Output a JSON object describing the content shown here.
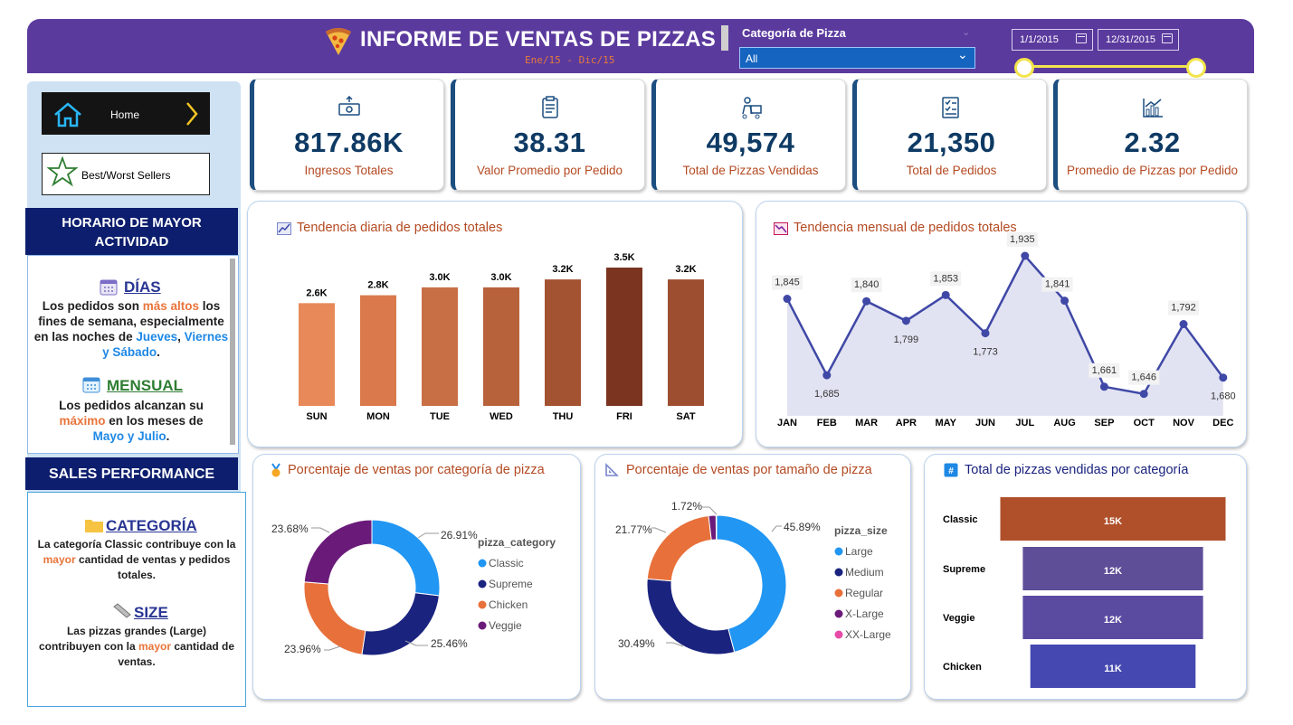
{
  "header": {
    "title": "INFORME DE VENTAS DE PIZZAS",
    "subtitle": "Ene/15 - Dic/15",
    "slicer_label": "Categoría de Pizza",
    "slicer_value": "All",
    "date_start": "1/1/2015",
    "date_end": "12/31/2015",
    "colors": {
      "header_bg": "#5b3a9e",
      "slider": "#f3e44c"
    }
  },
  "nav": {
    "home_label": "Home",
    "best_worst_label": "Best/Worst Sellers"
  },
  "insights": {
    "horario_header": "HORARIO DE MAYOR ACTIVIDAD",
    "dias_title": "DÍAS",
    "dias_text_a": "Los pedidos son ",
    "dias_text_b": "más altos",
    "dias_text_c": " los fines de semana, especialmente en las noches de ",
    "dias_text_d": "Jueves",
    "dias_text_e": ", ",
    "dias_text_f": "Viernes y Sábado",
    "dias_text_g": ".",
    "mensual_title": "MENSUAL",
    "mensual_text_a": "Los pedidos alcanzan su ",
    "mensual_text_b": "máximo",
    "mensual_text_c": " en los meses de ",
    "mensual_text_d": "Mayo y Julio",
    "mensual_text_e": ".",
    "sales_header": "SALES PERFORMANCE",
    "categoria_title": "CATEGORÍA",
    "categoria_text_a": "La categoría Classic contribuye con la ",
    "categoria_text_b": "mayor",
    "categoria_text_c": " cantidad de ventas y pedidos totales.",
    "size_title": "SIZE",
    "size_text_a": "Las pizzas grandes (Large) contribuyen con la ",
    "size_text_b": "mayor",
    "size_text_c": " cantidad de ventas."
  },
  "kpis": [
    {
      "value": "817.86K",
      "label": "Ingresos Totales",
      "icon": "money-icon"
    },
    {
      "value": "38.31",
      "label": "Valor Promedio por Pedido",
      "icon": "clipboard-icon"
    },
    {
      "value": "49,574",
      "label": "Total de Pizzas Vendidas",
      "icon": "delivery-icon"
    },
    {
      "value": "21,350",
      "label": "Total de Pedidos",
      "icon": "checklist-icon"
    },
    {
      "value": "2.32",
      "label": "Promedio de Pizzas por Pedido",
      "icon": "bar-chart-icon"
    }
  ],
  "chart_data": [
    {
      "type": "bar",
      "title": "Tendencia diaria de pedidos totales",
      "categories": [
        "SUN",
        "MON",
        "TUE",
        "WED",
        "THU",
        "FRI",
        "SAT"
      ],
      "values": [
        2.6,
        2.8,
        3.0,
        3.0,
        3.2,
        3.5,
        3.2
      ],
      "labels": [
        "2.6K",
        "2.8K",
        "3.0K",
        "3.0K",
        "3.2K",
        "3.5K",
        "3.2K"
      ],
      "colors": [
        "#e8895a",
        "#d9794c",
        "#c96f46",
        "#b8623c",
        "#a35232",
        "#7a3420",
        "#9e4e30"
      ]
    },
    {
      "type": "area",
      "title": "Tendencia mensual de pedidos totales",
      "categories": [
        "JAN",
        "FEB",
        "MAR",
        "APR",
        "MAY",
        "JUN",
        "JUL",
        "AUG",
        "SEP",
        "OCT",
        "NOV",
        "DEC"
      ],
      "values": [
        1845,
        1685,
        1840,
        1799,
        1853,
        1773,
        1935,
        1841,
        1661,
        1646,
        1792,
        1680
      ],
      "labels": [
        "1,845",
        "1,685",
        "1,840",
        "1,799",
        "1,853",
        "1,773",
        "1,935",
        "1,841",
        "1,661",
        "1,646",
        "1,792",
        "1,680"
      ],
      "colors": {
        "line": "#3f48a6",
        "fill": "#e2e3f2"
      }
    },
    {
      "type": "pie",
      "title": "Porcentaje de ventas por categoría de pizza",
      "legend_title": "pizza_category",
      "categories": [
        "Classic",
        "Supreme",
        "Chicken",
        "Veggie"
      ],
      "values": [
        26.91,
        25.46,
        23.96,
        23.68
      ],
      "labels": [
        "26.91%",
        "25.46%",
        "23.96%",
        "23.68%"
      ],
      "colors": [
        "#2196f3",
        "#1a237e",
        "#e8703a",
        "#6a1b7a"
      ]
    },
    {
      "type": "pie",
      "title": "Porcentaje de ventas por tamaño de pizza",
      "legend_title": "pizza_size",
      "categories": [
        "Large",
        "Medium",
        "Regular",
        "X-Large",
        "XX-Large"
      ],
      "values": [
        45.89,
        30.49,
        21.77,
        1.72,
        0.13
      ],
      "labels": [
        "45.89%",
        "30.49%",
        "21.77%",
        "1.72%"
      ],
      "colors": [
        "#2196f3",
        "#1a237e",
        "#e8703a",
        "#6a1b7a",
        "#e84aa8"
      ]
    },
    {
      "type": "bar",
      "orientation": "horizontal",
      "title": "Total de pizzas vendidas por categoría",
      "categories": [
        "Classic",
        "Supreme",
        "Veggie",
        "Chicken"
      ],
      "values": [
        15,
        12,
        12,
        11
      ],
      "labels": [
        "15K",
        "12K",
        "12K",
        "11K"
      ],
      "colors": [
        "#b0502a",
        "#5e4e98",
        "#5a4aa0",
        "#4448b0"
      ]
    }
  ]
}
